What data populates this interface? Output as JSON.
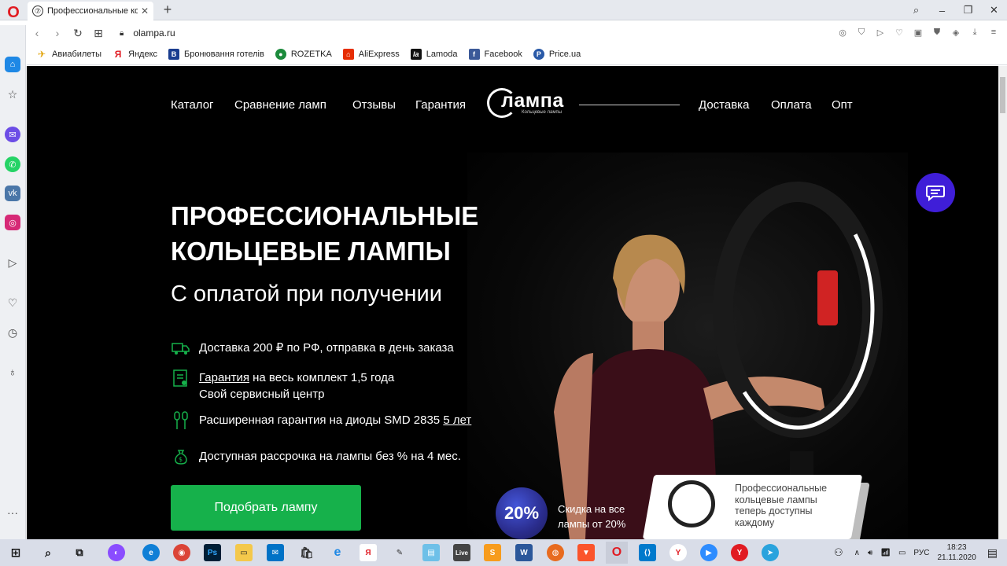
{
  "browser": {
    "tab_title": "Профессиональные кольц",
    "url": "olampa.ru",
    "bookmarks": [
      "Авиабилеты",
      "Яндекс",
      "Бронювання готелів",
      "ROZETKA",
      "AliExpress",
      "Lamoda",
      "Facebook",
      "Price.ua"
    ]
  },
  "nav": {
    "left": [
      "Каталог",
      "Сравнение ламп",
      "Отзывы",
      "Гарантия"
    ],
    "right": [
      "Доставка",
      "Оплата",
      "Опт"
    ]
  },
  "logo": {
    "text": "лампа",
    "sub": "Кольцевые лампы"
  },
  "hero": {
    "title": "Профессиональные кольцевые лампы",
    "subtitle": "С оплатой при получении",
    "features": {
      "delivery": "Доставка 200 ₽ по РФ, отправка в день заказа",
      "warranty_link": "Гарантия",
      "warranty_rest": " на весь комплект 1,5 года",
      "service": "Свой сервисный центр",
      "diodes": "Расширенная гарантия на диоды SMD 2835 ",
      "diodes_link": "5 лет",
      "installment": "Доступная рассрочка на лампы без % на 4 мес."
    },
    "cta": "Подобрать лампу"
  },
  "discount": {
    "badge": "20%",
    "line1": "Скидка на все",
    "line2": "лампы от 20%"
  },
  "promo": {
    "line1": "Профессиональные",
    "line2": "кольцевые лампы",
    "line3": "теперь доступны",
    "line4": "каждому"
  },
  "taskbar": {
    "lang": "РУС",
    "time": "18:23",
    "date": "21.11.2020"
  },
  "colors": {
    "accent_green": "#16b14b",
    "chat_purple": "#3f1ed8",
    "page_bg": "#000000"
  }
}
